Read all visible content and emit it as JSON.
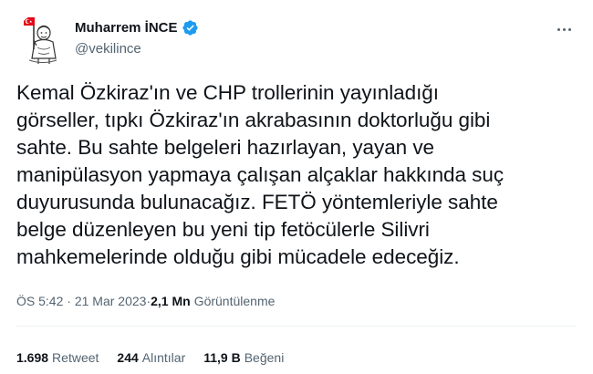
{
  "author": {
    "display_name": "Muharrem İNCE",
    "handle": "@vekilince",
    "verified": true,
    "verified_color": "#1d9bf0",
    "avatar_icon": "flag-mascot-avatar"
  },
  "tweet": {
    "lines": [
      "Kemal Özkiraz'ın ve CHP trollerinin yayınladığı",
      "görseller, tıpkı Özkiraz'ın akrabasının doktorluğu gibi",
      "sahte. Bu sahte belgeleri hazırlayan, yayan ve",
      "manipülasyon yapmaya çalışan alçaklar hakkında suç",
      "duyurusunda bulunacağız. FETÖ yöntemleriyle sahte",
      "belge düzenleyen bu yeni tip fetöcülerle Silivri",
      "mahkemelerinde olduğu gibi mücadele edeceğiz."
    ]
  },
  "meta": {
    "time": "ÖS 5:42",
    "separator": " · ",
    "date": "21 Mar 2023",
    "views_count": "2,1 Mn",
    "views_label": "Görüntülenme"
  },
  "stats": {
    "retweets": {
      "count": "1.698",
      "label": "Retweet"
    },
    "quotes": {
      "count": "244",
      "label": "Alıntılar"
    },
    "likes": {
      "count": "11,9 B",
      "label": "Beğeni"
    }
  },
  "colors": {
    "text_primary": "#0f1419",
    "text_secondary": "#536471",
    "divider": "#eff3f4",
    "flag_red": "#e30a17"
  }
}
